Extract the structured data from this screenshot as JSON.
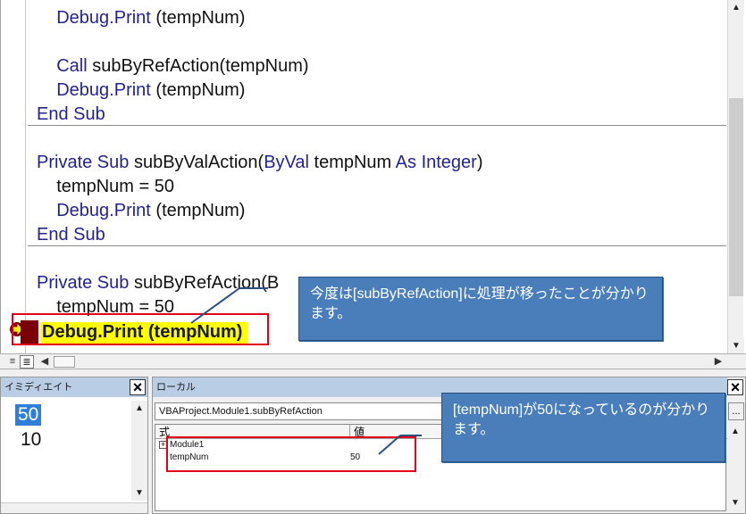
{
  "editor": {
    "lines": [
      {
        "segments": [
          {
            "t": "    ",
            "c": "tx"
          },
          {
            "t": "Debug.Print",
            "c": "kw"
          },
          {
            "t": " (tempNum)",
            "c": "tx"
          }
        ]
      },
      {
        "segments": [
          {
            "t": " ",
            "c": "tx"
          }
        ]
      },
      {
        "segments": [
          {
            "t": "    ",
            "c": "tx"
          },
          {
            "t": "Call",
            "c": "kw"
          },
          {
            "t": " subByRefAction(tempNum)",
            "c": "tx"
          }
        ]
      },
      {
        "segments": [
          {
            "t": "    ",
            "c": "tx"
          },
          {
            "t": "Debug.Print",
            "c": "kw"
          },
          {
            "t": " (tempNum)",
            "c": "tx"
          }
        ]
      },
      {
        "segments": [
          {
            "t": "End Sub",
            "c": "kw"
          }
        ]
      },
      {
        "segments": [
          {
            "t": " ",
            "c": "tx"
          }
        ]
      },
      {
        "segments": [
          {
            "t": "Private Sub",
            "c": "kw"
          },
          {
            "t": " subByValAction(",
            "c": "tx"
          },
          {
            "t": "ByVal",
            "c": "kw"
          },
          {
            "t": " tempNum ",
            "c": "tx"
          },
          {
            "t": "As Integer",
            "c": "kw"
          },
          {
            "t": ")",
            "c": "tx"
          }
        ]
      },
      {
        "segments": [
          {
            "t": "    tempNum = 50",
            "c": "tx"
          }
        ]
      },
      {
        "segments": [
          {
            "t": "    ",
            "c": "tx"
          },
          {
            "t": "Debug.Print",
            "c": "kw"
          },
          {
            "t": " (tempNum)",
            "c": "tx"
          }
        ]
      },
      {
        "segments": [
          {
            "t": "End Sub",
            "c": "kw"
          }
        ]
      },
      {
        "segments": [
          {
            "t": " ",
            "c": "tx"
          }
        ]
      },
      {
        "segments": [
          {
            "t": "Private Sub",
            "c": "kw"
          },
          {
            "t": " subByRefAction(B",
            "c": "tx"
          }
        ]
      },
      {
        "segments": [
          {
            "t": "    tempNum = 50",
            "c": "tx"
          }
        ]
      }
    ],
    "current_statement": "Debug.Print (tempNum)"
  },
  "immediate": {
    "title": "イミディエイト",
    "lines": [
      "50",
      "10"
    ]
  },
  "locals": {
    "title": "ローカル",
    "context": "VBAProject.Module1.subByRefAction",
    "context_button": "...",
    "columns": [
      "式",
      "値"
    ],
    "rows": [
      {
        "expr": "Module1",
        "value": ""
      },
      {
        "expr": "tempNum",
        "value": "50"
      }
    ]
  },
  "callouts": {
    "editor_note": "今度は[subByRefAction]に処理が移ったことが分かります。",
    "locals_note": "[tempNum]が50になっているのが分かります。"
  },
  "icons": {
    "close": "close-icon",
    "exec_pointer": "execution-arrow-icon",
    "expand": "expand-plus-icon"
  },
  "colors": {
    "keyword": "#23238e",
    "highlight": "#ffff00",
    "breakpoint": "#7a0000",
    "callout": "#4a7ebb",
    "annotation_border": "#e0001a",
    "pane_title": "#b9cde4",
    "selection": "#2f7fd8"
  }
}
